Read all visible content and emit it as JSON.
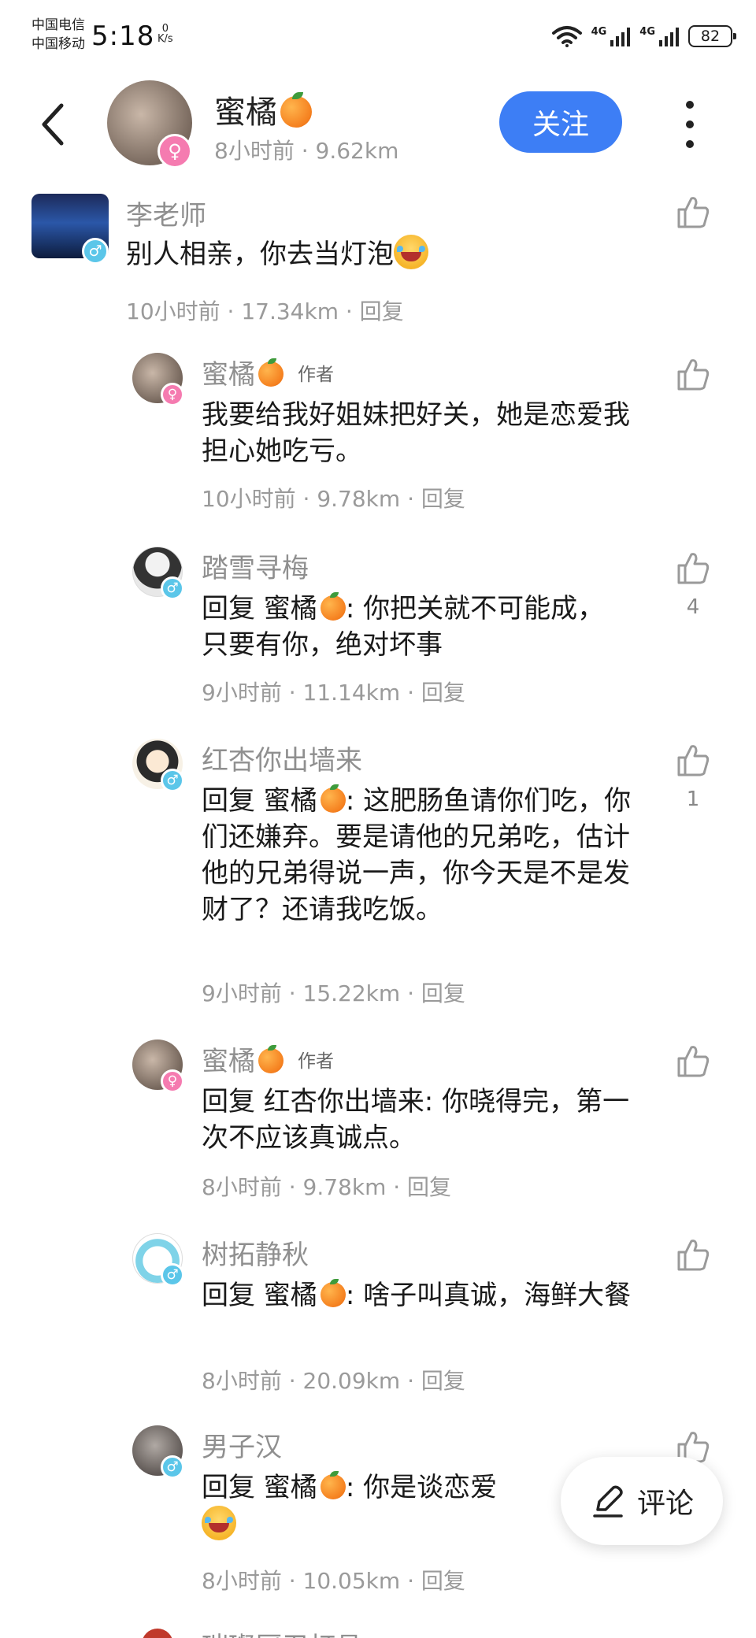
{
  "status_bar": {
    "carrier1": "中国电信",
    "carrier2": "中国移动",
    "time": "5:18",
    "net_speed_value": "0",
    "net_speed_unit": "K/s",
    "signal1_label": "4G",
    "signal2_label": "4G",
    "battery": "82"
  },
  "header": {
    "name": "蜜橘",
    "meta": "8小时前 · 9.62km",
    "follow_label": "关注"
  },
  "comments": [
    {
      "name": "李老师",
      "text": "别人相亲，你去当灯泡",
      "meta": "10小时前 · 17.34km · 回复",
      "gender": "male"
    },
    {
      "name": "蜜橘",
      "author_tag": "作者",
      "text": "我要给我好姐妹把好关，她是恋爱我担心她吃亏。",
      "meta": "10小时前 · 9.78km · 回复",
      "gender": "female"
    },
    {
      "name": "踏雪寻梅",
      "reply_prefix": "回复 蜜橘",
      "text": ": 你把关就不可能成，只要有你，绝对坏事",
      "meta": "9小时前 · 11.14km · 回复",
      "likes": "4",
      "gender": "male"
    },
    {
      "name": "红杏你出墙来",
      "reply_prefix": "回复 蜜橘",
      "text": ": 这肥肠鱼请你们吃，你们还嫌弃。要是请他的兄弟吃，估计他的兄弟得说一声，你今天是不是发财了？还请我吃饭。",
      "meta": "9小时前 · 15.22km · 回复",
      "likes": "1",
      "gender": "male"
    },
    {
      "name": "蜜橘",
      "author_tag": "作者",
      "text": "回复 红杏你出墙来: 你晓得完，第一次不应该真诚点。",
      "meta": "8小时前 · 9.78km · 回复",
      "gender": "female"
    },
    {
      "name": "树拓静秋",
      "reply_prefix": "回复 蜜橘",
      "text": ": 啥子叫真诚，海鲜大餐",
      "meta": "8小时前 · 20.09km · 回复",
      "gender": "male"
    },
    {
      "name": "男子汉",
      "reply_prefix": "回复 蜜橘",
      "text": ": 你是谈恋爱",
      "meta": "8小时前 · 10.05km · 回复",
      "gender": "male"
    },
    {
      "name": "璀璨厨卫灯具"
    }
  ],
  "float_button": {
    "label": "评论",
    "icon": "pencil-icon"
  },
  "colors": {
    "accent": "#3d7ef5",
    "female": "#f57bb0",
    "male": "#5bc6e9",
    "meta_gray": "#9a9a9a"
  }
}
